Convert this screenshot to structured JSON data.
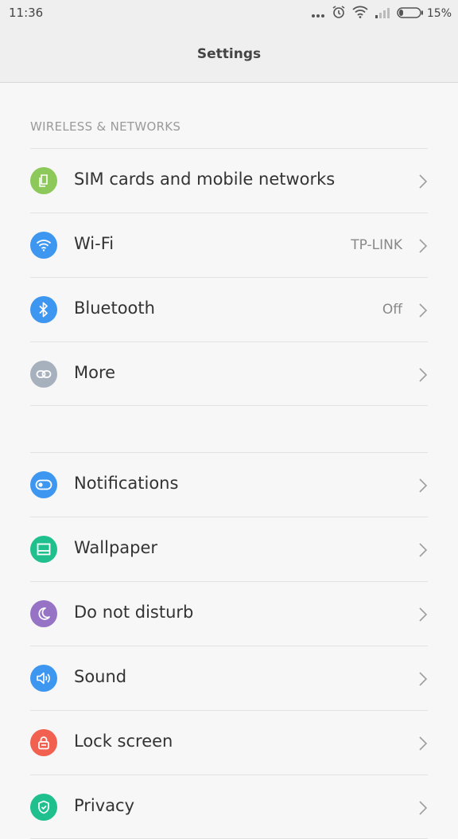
{
  "status_bar": {
    "time": "11:36",
    "battery_percent": "15%",
    "icons": [
      "more-dots-icon",
      "alarm-icon",
      "wifi-icon",
      "signal-icon",
      "battery-icon"
    ]
  },
  "header": {
    "title": "Settings"
  },
  "wireless_section": {
    "header": "WIRELESS & NETWORKS",
    "items": [
      {
        "label": "SIM cards and mobile networks",
        "value": "",
        "icon": "sim-card-icon",
        "color": "#8cc85a"
      },
      {
        "label": "Wi-Fi",
        "value": "TP-LINK",
        "icon": "wifi-icon",
        "color": "#3d97f0"
      },
      {
        "label": "Bluetooth",
        "value": "Off",
        "icon": "bluetooth-icon",
        "color": "#3d97f0"
      },
      {
        "label": "More",
        "value": "",
        "icon": "link-icon",
        "color": "#a7b1bd"
      }
    ]
  },
  "device_section": {
    "items": [
      {
        "label": "Notifications",
        "icon": "notifications-toggle-icon",
        "color": "#3d97f0"
      },
      {
        "label": "Wallpaper",
        "icon": "wallpaper-icon",
        "color": "#1fc08e"
      },
      {
        "label": "Do not disturb",
        "icon": "moon-icon",
        "color": "#9673c4"
      },
      {
        "label": "Sound",
        "icon": "speaker-icon",
        "color": "#3d97f0"
      },
      {
        "label": "Lock screen",
        "icon": "lock-icon",
        "color": "#f2604f"
      },
      {
        "label": "Privacy",
        "icon": "shield-icon",
        "color": "#1fc08e"
      }
    ]
  }
}
